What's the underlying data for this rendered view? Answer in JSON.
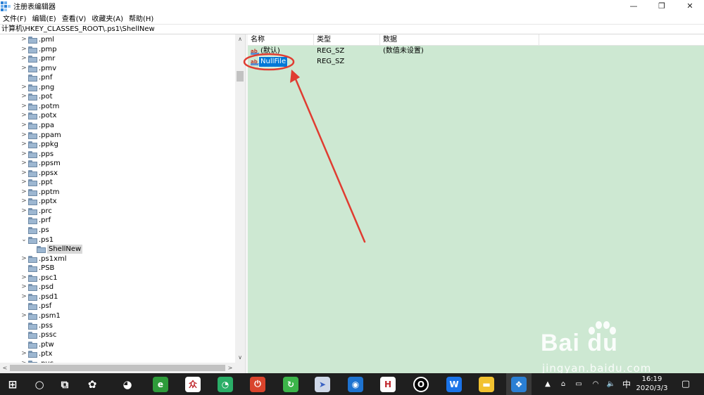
{
  "window": {
    "title": "注册表编辑器",
    "controls": {
      "minimize": "—",
      "maximize": "❐",
      "close": "✕"
    }
  },
  "menu": [
    "文件(F)",
    "编辑(E)",
    "查看(V)",
    "收藏夹(A)",
    "帮助(H)"
  ],
  "address": "计算机\\HKEY_CLASSES_ROOT\\.ps1\\ShellNew",
  "tree": [
    {
      "label": ".pml",
      "chevron": ">",
      "depth": 0
    },
    {
      "label": ".pmp",
      "chevron": ">",
      "depth": 0
    },
    {
      "label": ".pmr",
      "chevron": ">",
      "depth": 0
    },
    {
      "label": ".pmv",
      "chevron": ">",
      "depth": 0
    },
    {
      "label": ".pnf",
      "chevron": "",
      "depth": 0
    },
    {
      "label": ".png",
      "chevron": ">",
      "depth": 0
    },
    {
      "label": ".pot",
      "chevron": ">",
      "depth": 0
    },
    {
      "label": ".potm",
      "chevron": ">",
      "depth": 0
    },
    {
      "label": ".potx",
      "chevron": ">",
      "depth": 0
    },
    {
      "label": ".ppa",
      "chevron": ">",
      "depth": 0
    },
    {
      "label": ".ppam",
      "chevron": ">",
      "depth": 0
    },
    {
      "label": ".ppkg",
      "chevron": ">",
      "depth": 0
    },
    {
      "label": ".pps",
      "chevron": ">",
      "depth": 0
    },
    {
      "label": ".ppsm",
      "chevron": ">",
      "depth": 0
    },
    {
      "label": ".ppsx",
      "chevron": ">",
      "depth": 0
    },
    {
      "label": ".ppt",
      "chevron": ">",
      "depth": 0
    },
    {
      "label": ".pptm",
      "chevron": ">",
      "depth": 0
    },
    {
      "label": ".pptx",
      "chevron": ">",
      "depth": 0
    },
    {
      "label": ".prc",
      "chevron": ">",
      "depth": 0
    },
    {
      "label": ".prf",
      "chevron": "",
      "depth": 0
    },
    {
      "label": ".ps",
      "chevron": "",
      "depth": 0
    },
    {
      "label": ".ps1",
      "chevron": "⌄",
      "depth": 0
    },
    {
      "label": "ShellNew",
      "chevron": "",
      "depth": 1,
      "selected": true
    },
    {
      "label": ".ps1xml",
      "chevron": ">",
      "depth": 0
    },
    {
      "label": ".PSB",
      "chevron": "",
      "depth": 0
    },
    {
      "label": ".psc1",
      "chevron": ">",
      "depth": 0
    },
    {
      "label": ".psd",
      "chevron": ">",
      "depth": 0
    },
    {
      "label": ".psd1",
      "chevron": ">",
      "depth": 0
    },
    {
      "label": ".psf",
      "chevron": "",
      "depth": 0
    },
    {
      "label": ".psm1",
      "chevron": ">",
      "depth": 0
    },
    {
      "label": ".pss",
      "chevron": "",
      "depth": 0
    },
    {
      "label": ".pssc",
      "chevron": "",
      "depth": 0
    },
    {
      "label": ".ptw",
      "chevron": "",
      "depth": 0
    },
    {
      "label": ".ptx",
      "chevron": ">",
      "depth": 0
    },
    {
      "label": ".pyc",
      "chevron": ">",
      "depth": 0
    }
  ],
  "columns": {
    "name": "名称",
    "type": "类型",
    "data": "数据"
  },
  "values": [
    {
      "name": "(默认)",
      "type": "REG_SZ",
      "data": "(数值未设置)",
      "selected": false
    },
    {
      "name": "NullFile",
      "type": "REG_SZ",
      "data": "",
      "selected": true
    }
  ],
  "icons": {
    "value_icon": "ab",
    "scroll_up": "∧",
    "scroll_down": "∨",
    "scroll_left": "<",
    "scroll_right": ">"
  },
  "annotation": {
    "color": "#e03c31"
  },
  "watermark": {
    "brand": "Bai du",
    "url": "jingyan.baidu.com"
  },
  "taskbar": {
    "apps": [
      {
        "name": "start-icon",
        "glyph": "⊞",
        "color": ""
      },
      {
        "name": "search-icon",
        "glyph": "○",
        "color": ""
      },
      {
        "name": "task-view-icon",
        "glyph": "⧉",
        "color": ""
      },
      {
        "name": "pinwheel-app-icon",
        "glyph": "✿",
        "color": ""
      },
      {
        "name": "qq-icon",
        "glyph": "◕",
        "color": ""
      },
      {
        "name": "browser-icon",
        "glyph": "e",
        "color": "#2e9b3a"
      },
      {
        "name": "red-app-icon",
        "glyph": "众",
        "color": "#ffffff"
      },
      {
        "name": "wechat-icon",
        "glyph": "◔",
        "color": "#2aae67"
      },
      {
        "name": "power-app-icon",
        "glyph": "⏻",
        "color": "#d9442c"
      },
      {
        "name": "refresh-app-icon",
        "glyph": "↻",
        "color": "#3cb54a"
      },
      {
        "name": "paper-plane-icon",
        "glyph": "➤",
        "color": "#cfd8e8"
      },
      {
        "name": "penguin-app-icon",
        "glyph": "◉",
        "color": "#1e73d0"
      },
      {
        "name": "h-app-icon",
        "glyph": "H",
        "color": "#ffffff"
      },
      {
        "name": "ring-app-icon",
        "glyph": "O",
        "color": "#000000"
      },
      {
        "name": "wps-icon",
        "glyph": "W",
        "color": "#1a73e8"
      },
      {
        "name": "file-explorer-icon",
        "glyph": "▬",
        "color": "#f2c230"
      },
      {
        "name": "regedit-icon",
        "glyph": "❖",
        "color": "#2a7fd4"
      }
    ],
    "tray": [
      "▲",
      "⌂",
      "▭",
      "◠",
      "🔈",
      "中"
    ],
    "time": "16:19",
    "date": "2020/3/3",
    "notification_glyph": "▢"
  }
}
